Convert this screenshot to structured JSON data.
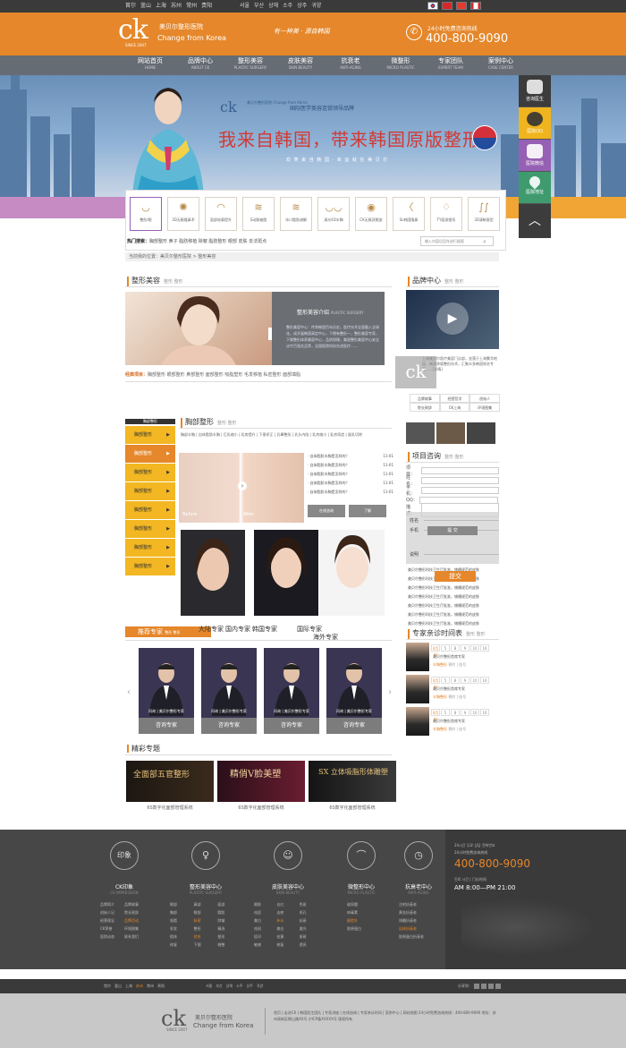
{
  "topbar": {
    "cities": [
      "首尔",
      "釜山",
      "上海",
      "苏州",
      "常州",
      "贵阳"
    ],
    "cities2": [
      "서울",
      "부산",
      "상해",
      "소주",
      "상주",
      "귀양"
    ],
    "flags": [
      "#ffffff",
      "#d62828",
      "#e23a2e",
      "#ffffff"
    ]
  },
  "header": {
    "logo_ck": "ck",
    "logo_since": "SINCE 2007",
    "logo_cn": "美贝尔整形医院",
    "logo_en": "Change from Korea",
    "slogan": "有一种美 · 源自韩国",
    "phone_label": "24小时免费咨询热线",
    "phone": "400-800-9090"
  },
  "nav": [
    {
      "cn": "网站首页",
      "en": "HOME"
    },
    {
      "cn": "品牌中心",
      "en": "ABOUT CK"
    },
    {
      "cn": "整形美容",
      "en": "PLASTIC SURGERY"
    },
    {
      "cn": "皮肤美容",
      "en": "SKIN BEAUTY"
    },
    {
      "cn": "抗衰老",
      "en": "ANTI-AGING"
    },
    {
      "cn": "微整形",
      "en": "MICRO PLASTIC"
    },
    {
      "cn": "专家团队",
      "en": "EXPERT TEAM"
    },
    {
      "cn": "案例中心",
      "en": "CASE CENTER"
    }
  ],
  "banner": {
    "ck": "ck",
    "ck_name": "美贝尔整形医院 Change from Korea",
    "sub": "国际医学美容连锁领导品牌",
    "title": "我来自韩国，带来韩国原版整形",
    "tag": "欢 笑 来 自 韩 国 · 幸 运 就 在 美 贝 尔"
  },
  "float": [
    {
      "label": "咨询医生",
      "icon": "chat-icon"
    },
    {
      "label": "医院QQ",
      "icon": "qq-icon"
    },
    {
      "label": "医院微信",
      "icon": "wechat-icon"
    },
    {
      "label": "医院地址",
      "icon": "map-pin-icon"
    },
    {
      "label": "",
      "icon": "chevron-up-icon"
    }
  ],
  "categories": [
    {
      "glyph": "◡",
      "label": "整形/眼"
    },
    {
      "glyph": "✺",
      "label": "3D无痕隆鼻术"
    },
    {
      "glyph": "◠",
      "label": "面部轮廓提升"
    },
    {
      "glyph": "≋",
      "label": "S动脉抽脂"
    },
    {
      "glyph": "≋",
      "label": "冰川脂肪溶解"
    },
    {
      "glyph": "◡◡",
      "label": "清光4D丰胸"
    },
    {
      "glyph": "◉",
      "label": "CK无痕双眼皮"
    },
    {
      "glyph": "〈",
      "label": "SL韩国隆鼻"
    },
    {
      "glyph": "♢",
      "label": "TY面部塑形"
    },
    {
      "glyph": "∫∫",
      "label": "3D清晰眉型"
    }
  ],
  "hot": {
    "label": "热门搜索：",
    "items": "胸部整形  鼻子  脂肪移植  除皱  脂肪整形  眼部  皮肤  去法斑点"
  },
  "search_placeholder": "输入内容后回车进行搜索",
  "crumb": "当前我的位置：美贝尔整形医院 > 整形美容",
  "plastic": {
    "title": "整形美容",
    "sub": "整形 整形",
    "box_title": "整形美容介绍",
    "box_en": "PLASTIC SURGERY",
    "box_desc": "整形美容中心：传承韩国百年历史，医疗技术全面融入全球化，成开展韩国高定中心，下拥有整形一，整形美容专家，下属整形体养美容中心，品质保障，美丽整形美容中心安全诊疗百强名品等，全国医院科技先进医疗......",
    "list_label": "经典项目：",
    "list": "胸部整形  眼部整形  鼻部整形  面部整形  吸脂塑形  毛发移植  私密整形  面部填脂"
  },
  "tabs": {
    "head": "胸部整形",
    "items": [
      "胸部整形",
      "胸部整形",
      "胸部整形",
      "胸部整形",
      "胸部整形",
      "胸部整形",
      "胸部整形",
      "胸部整形",
      "胸部整形",
      "胸部整形"
    ]
  },
  "breast": {
    "title": "胸部整形",
    "sub": "整形 整形",
    "desc": "胸部丰胸 | 自体脂肪丰胸 | 巨乳缩小 | 乳房提升 | 下垂矫正 | 乳晕整形 | 乳头内陷 | 乳房缩小 | 乳房再造 | 副乳切除",
    "before": "Before",
    "after": "After",
    "questions": [
      "自体脂肪丰胸是怎样的？",
      "自体脂肪丰胸是怎样的？",
      "自体脂肪丰胸是怎样的？",
      "自体脂肪丰胸是怎样的？",
      "自体脂肪丰胸是怎样的？",
      "自体脂肪丰胸是怎样的？"
    ],
    "dates": [
      "11-01",
      "11-01",
      "11-01",
      "11-01",
      "11-01",
      "11-01"
    ],
    "btn1": "在线咨询",
    "btn2": "了解"
  },
  "experts": {
    "title": "推荐专家",
    "sub": "整形 整形",
    "tabs": [
      "大陆专家",
      "国内专家",
      "韩国专家",
      "国际专家",
      "海外专家"
    ],
    "items": [
      {
        "name": "问询 | 美贝尔整形专家",
        "btn": "咨询专家"
      },
      {
        "name": "问询 | 美贝尔整形专家",
        "btn": "咨询专家"
      },
      {
        "name": "问询 | 美贝尔整形专家",
        "btn": "咨询专家"
      },
      {
        "name": "问询 | 美贝尔整形专家",
        "btn": "咨询专家"
      }
    ]
  },
  "topics": {
    "title": "精彩专题",
    "items": [
      {
        "img": "全面部五官整形",
        "cap": "6S数字化面部管理系统"
      },
      {
        "img": "精俏V脸美塑",
        "cap": "6S数字化面部管理系统"
      },
      {
        "img": "SX 立体吸脂形体雕塑",
        "cap": "6S数字化面部管理系统"
      }
    ]
  },
  "brand": {
    "title": "品牌中心",
    "sub": "整形 整形",
    "text": "上海美贝尔医疗美容门诊部，坐落于上海繁华地段，韩国原版整形技术，汇聚众多韩国知名专家......[详情]",
    "ck": "ck",
    "grid1": [
      "品牌故事",
      "经营哲学",
      "创始人"
    ],
    "grid2": [
      "院长致辞",
      "CK上海",
      "环境图集"
    ]
  },
  "consult": {
    "title": "项目咨询",
    "sub": "整形 整形",
    "fields": [
      "项目：",
      "姓名：",
      "手机：",
      "QQ：",
      "描述："
    ],
    "overlay_fields": [
      "姓名",
      "手机",
      "说明"
    ],
    "submit1": "提 交",
    "submit2": "提交",
    "news": [
      "美贝尔整形科技卫生厅批准，铺槽规范的皮肤",
      "美贝尔整形科技卫生厅批准，铺槽规范的皮肤",
      "美贝尔整形科技卫生厅批准，铺槽规范的皮肤",
      "美贝尔整形科技卫生厅批准，铺槽规范的皮肤",
      "美贝尔整形科技卫生厅批准，铺槽规范的皮肤",
      "美贝尔整形科技卫生厅批准，铺槽规范的皮肤",
      "美贝尔整形科技卫生厅批准，铺槽规范的皮肤"
    ]
  },
  "schedule": {
    "title": "专家亲诊时间表",
    "sub": "整形 整形",
    "days": [
      "4月份",
      "5",
      "8",
      "9",
      "10",
      "16"
    ],
    "name": "美贝尔整形首席专家",
    "dept": "丰胸整形",
    "links": "预约 | 挂号"
  },
  "footer": {
    "cols": [
      {
        "glyph": "印象",
        "title": "CK印象",
        "sub": "CK IMPRESSION",
        "links": [
          "品牌简介",
          "品牌故事",
          "创始人记",
          "院长致辞",
          "经营理念",
          "品牌活动",
          "CK荣誉",
          "环境图集",
          "医院动态",
          "联系我们"
        ]
      },
      {
        "glyph": "♀",
        "title": "整形美容中心",
        "sub": "PLASTIC SURGERY",
        "links": [
          "眼部",
          "鼻部",
          "面部",
          "胸部",
          "眼部",
          "脂肪",
          "吸脂",
          "私密",
          "除皱",
          "毛发",
          "整形",
          "精选",
          "假体",
          "综合",
          "塑形",
          "修复",
          "下颌",
          "微整"
        ]
      },
      {
        "glyph": "☺",
        "title": "皮肤美容中心",
        "sub": "SKIN BEAUTY",
        "links": [
          "嫩肤",
          "去红",
          "色斑",
          "祛痘",
          "去疤",
          "毛孔",
          "美白",
          "补水",
          "抗衰",
          "祛斑",
          "美白",
          "激光",
          "痘印",
          "祛黄",
          "紧致",
          "敏感",
          "修复",
          "透亮"
        ]
      },
      {
        "glyph": "⌒",
        "title": "微整形中心",
        "sub": "MICRO PLASTIC",
        "links": [
          "玻尿酸",
          "肉毒素",
          "瘦脸针",
          "胶原蛋白"
        ]
      },
      {
        "glyph": "◷",
        "title": "抗衰老中心",
        "sub": "ANTI-AGING",
        "links": [
          "注射抗衰老",
          "黄金抗衰老",
          "线雕抗衰老",
          "自体抗衰老",
          "胶原蛋白抗衰老"
        ]
      }
    ],
    "hours1": "24시간 무료 상담 전화번호",
    "hours2": "24小时免费咨询热线",
    "phone": "400-800-9090",
    "time1": "진료 시간 | 门诊时间",
    "time2": "AM 8:00—PM 21:00"
  },
  "fbar": {
    "c1": [
      "首尔",
      "釜山",
      "上海",
      "苏州",
      "常州",
      "贵阳"
    ],
    "c2": [
      "서울",
      "부산",
      "상해",
      "소주",
      "상주",
      "귀양"
    ],
    "share": "分享到："
  },
  "fbottom": {
    "ck": "ck",
    "since": "SINCE 2007",
    "cn": "美贝尔整形医院",
    "en": "Change from Korea",
    "links": "首页 | 走进CK | 韩国医生团队 | 专家讲座 | 在线咨询 | 专家亲诊时间 | 案例中心 | 网站地图  24小时免费咨询热线：400-800-9090  地址：苏州高新区狮山路XX号  沪ICP备XXXXX号  版权所有"
  }
}
